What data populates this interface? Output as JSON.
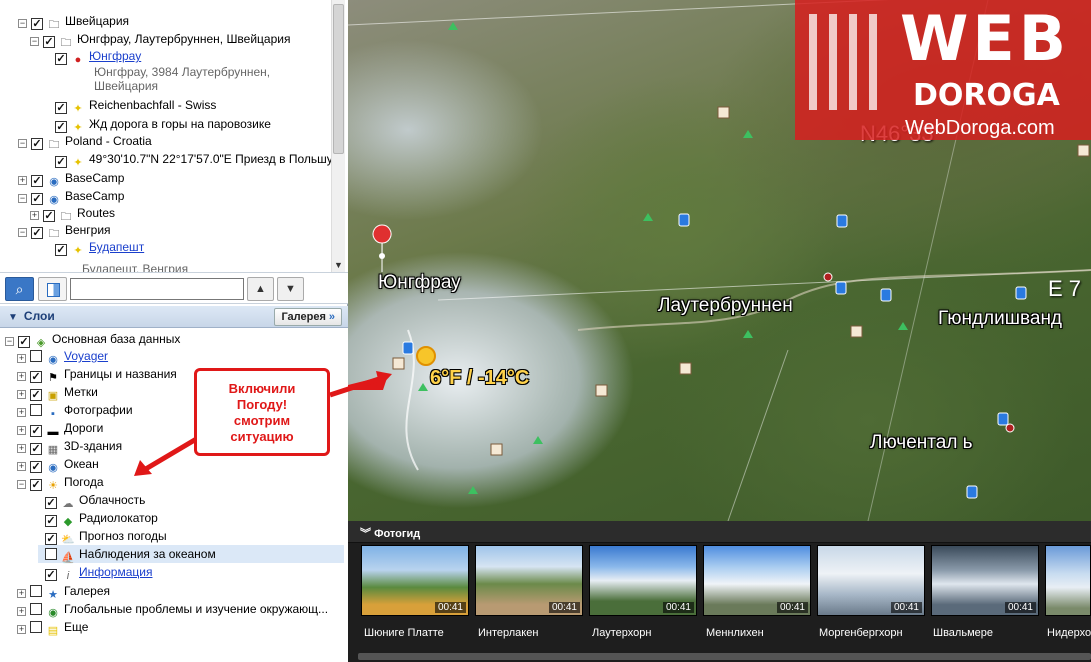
{
  "places": {
    "items": [
      {
        "label": "Швейцария"
      },
      {
        "label": "Юнгфрау, Лаутербруннен, Швейцария"
      },
      {
        "label": "Юнгфрау",
        "sub1": "Юнгфрау, 3984 Лаутербруннен,",
        "sub2": "Швейцария"
      },
      {
        "label": "Reichenbachfall - Swiss"
      },
      {
        "label": "Жд дорога в горы на паровозике"
      },
      {
        "label": "Poland - Croatia"
      },
      {
        "label": "49°30'10.7\"N 22°17'57.0\"E Приезд в Польшу"
      },
      {
        "label": "BaseCamp"
      },
      {
        "label": "BaseCamp"
      },
      {
        "label": "Routes"
      },
      {
        "label": "Венгрия"
      },
      {
        "label": "Будапешт",
        "sub1": "Будапешт, Венгрия"
      }
    ]
  },
  "toolbar": {
    "search_value": ""
  },
  "layers": {
    "title": "Слои",
    "gallery_button": "Галерея",
    "items": [
      {
        "label": "Основная база данных"
      },
      {
        "label": "Voyager"
      },
      {
        "label": "Границы и названия"
      },
      {
        "label": "Метки"
      },
      {
        "label": "Фотографии"
      },
      {
        "label": "Дороги"
      },
      {
        "label": "3D-здания"
      },
      {
        "label": "Океан"
      },
      {
        "label": "Погода"
      },
      {
        "label": "Облачность"
      },
      {
        "label": "Радиолокатор"
      },
      {
        "label": "Прогноз погоды"
      },
      {
        "label": "Наблюдения за океаном"
      },
      {
        "label": "Информация"
      },
      {
        "label": "Галерея"
      },
      {
        "label": "Глобальные проблемы и изучение окружающ..."
      },
      {
        "label": "Еще"
      }
    ]
  },
  "map": {
    "labels": {
      "jungfrau": "Юнгфрау",
      "lauterbrunnen": "Лаутербруннен",
      "gundlischwand": "Гюндлишванд",
      "luchental": "Лючентал ь",
      "temperature": "6°F / -14°C",
      "coord_top": "N46°33'",
      "coord_right": "E 7"
    }
  },
  "watermark": {
    "web": "WEB",
    "doroga": "DOROGA",
    "url": "WebDoroga.com"
  },
  "callout": {
    "line1": "Включили",
    "line2": "Погоду!",
    "line3": "смотрим",
    "line4": "ситуацию"
  },
  "photo_guide": {
    "title": "Фотогид",
    "items": [
      {
        "caption": "Шюниге Платте",
        "duration": "00:41"
      },
      {
        "caption": "Интерлакен",
        "duration": "00:41"
      },
      {
        "caption": "Лаутерхорн",
        "duration": "00:41"
      },
      {
        "caption": "Меннлихен",
        "duration": "00:41"
      },
      {
        "caption": "Моргенбергхорн",
        "duration": "00:41"
      },
      {
        "caption": "Швальмере",
        "duration": "00:41"
      },
      {
        "caption": "Нидерхо",
        "duration": ""
      }
    ]
  },
  "colors": {
    "accent": "#e01818",
    "link": "#1a3fcc",
    "layers_header": "#1d3f78"
  }
}
